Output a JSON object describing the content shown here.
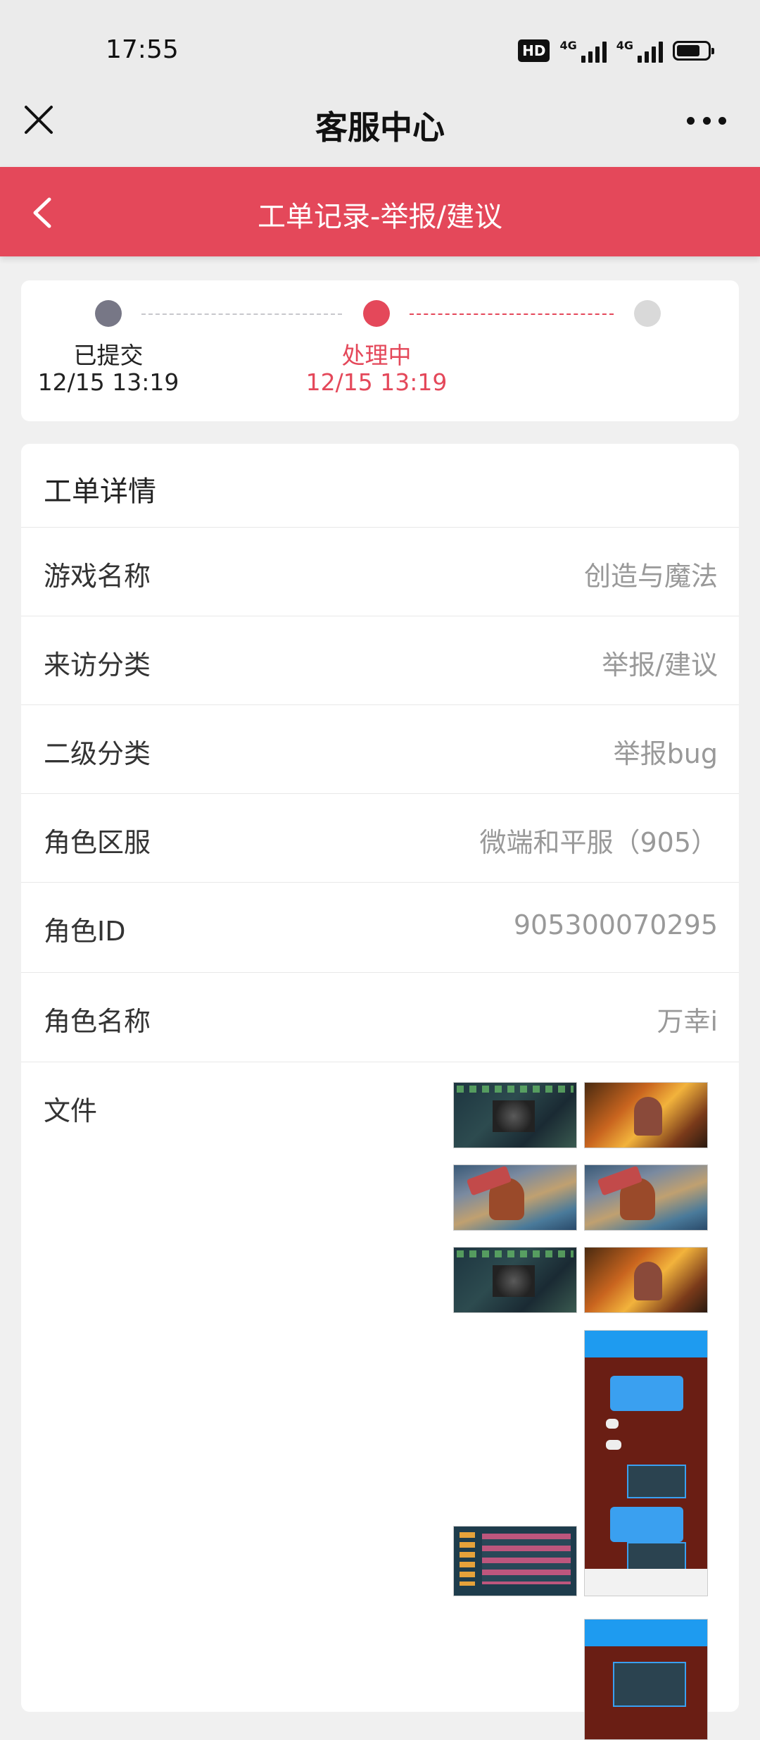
{
  "status_bar": {
    "time": "17:55",
    "hd_badge": "HD",
    "sim1_label": "4G",
    "sim2_label": "4G",
    "battery_level": 0.75
  },
  "nav": {
    "title": "客服中心",
    "close_icon": "close-icon",
    "more_icon": "more-icon"
  },
  "header": {
    "title": "工单记录-举报/建议",
    "back_icon": "chevron-left-icon",
    "color": "#e4485a"
  },
  "progress": {
    "steps": [
      {
        "label": "已提交",
        "time": "12/15 13:19",
        "state": "done"
      },
      {
        "label": "处理中",
        "time": "12/15 13:19",
        "state": "active"
      },
      {
        "label": "",
        "time": "",
        "state": "pending"
      }
    ],
    "colors": {
      "done": "#777786",
      "active": "#e4485a",
      "pending": "#d9d9d9"
    }
  },
  "details": {
    "heading": "工单详情",
    "rows": [
      {
        "label": "游戏名称",
        "value": "创造与魔法"
      },
      {
        "label": "来访分类",
        "value": "举报/建议"
      },
      {
        "label": "二级分类",
        "value": "举报bug"
      },
      {
        "label": "角色区服",
        "value": "微端和平服（905）"
      },
      {
        "label": "角色ID",
        "value": "905300070295"
      },
      {
        "label": "角色名称",
        "value": "万幸i"
      }
    ],
    "files_label": "文件",
    "files": [
      {
        "kind": "game-screenshot"
      },
      {
        "kind": "game-screenshot"
      },
      {
        "kind": "game-screenshot"
      },
      {
        "kind": "game-screenshot"
      },
      {
        "kind": "game-screenshot"
      },
      {
        "kind": "game-screenshot"
      },
      {
        "kind": "game-screenshot"
      },
      {
        "kind": "chat-screenshot"
      },
      {
        "kind": "chat-screenshot"
      }
    ]
  }
}
